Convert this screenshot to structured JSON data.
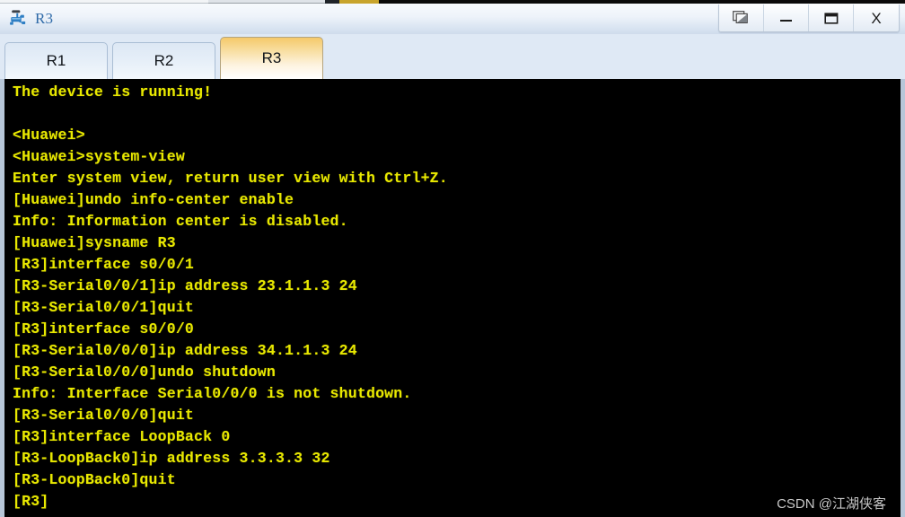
{
  "window": {
    "title": "R3",
    "icon": "router-icon",
    "controls": [
      {
        "name": "cascade-windows-button",
        "glyph": "cascade"
      },
      {
        "name": "minimize-button",
        "glyph": "minimize"
      },
      {
        "name": "maximize-button",
        "glyph": "maximize"
      },
      {
        "name": "close-button",
        "glyph": "X"
      }
    ]
  },
  "tabs": [
    {
      "label": "R1",
      "active": false
    },
    {
      "label": "R2",
      "active": false
    },
    {
      "label": "R3",
      "active": true
    }
  ],
  "terminal": {
    "background_color": "#000000",
    "text_color": "#e8e800",
    "lines": [
      "The device is running!",
      "",
      "<Huawei>",
      "<Huawei>system-view",
      "Enter system view, return user view with Ctrl+Z.",
      "[Huawei]undo info-center enable",
      "Info: Information center is disabled.",
      "[Huawei]sysname R3",
      "[R3]interface s0/0/1",
      "[R3-Serial0/0/1]ip address 23.1.1.3 24",
      "[R3-Serial0/0/1]quit",
      "[R3]interface s0/0/0",
      "[R3-Serial0/0/0]ip address 34.1.1.3 24",
      "[R3-Serial0/0/0]undo shutdown",
      "Info: Interface Serial0/0/0 is not shutdown.",
      "[R3-Serial0/0/0]quit",
      "[R3]interface LoopBack 0",
      "[R3-LoopBack0]ip address 3.3.3.3 32",
      "[R3-LoopBack0]quit",
      "[R3]"
    ]
  },
  "watermark": {
    "text": "CSDN @江湖侠客"
  }
}
